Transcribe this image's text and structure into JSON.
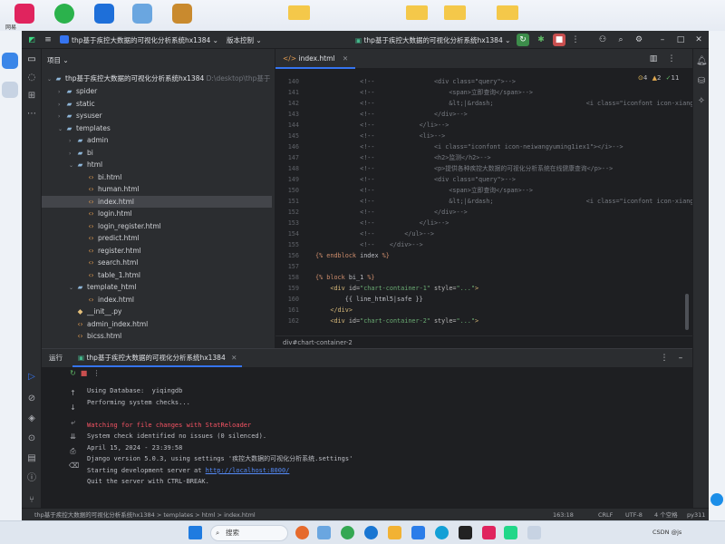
{
  "desktop": {
    "icons": [
      {
        "name": "app-1",
        "color": "#e0245e"
      },
      {
        "name": "app-2",
        "color": "#2bb24c"
      },
      {
        "name": "app-3",
        "color": "#1e6fd9"
      },
      {
        "name": "app-4",
        "color": "#6aa6e0"
      },
      {
        "name": "app-5",
        "color": "#c98a2e"
      }
    ],
    "top_label": "网易"
  },
  "titlebar": {
    "project": "thp基于疾控大数据的可视化分析系统hx1384",
    "vcs": "版本控制",
    "run_config": "thp基于疾控大数据的可视化分析系统hx1384"
  },
  "project_panel": {
    "header": "项目",
    "root": "thp基于疾控大数据的可视化分析系统hx1384",
    "root_path": "D:\\desktop\\thp基于",
    "tree": [
      {
        "label": "spider",
        "type": "folder",
        "depth": 1,
        "arrow": "›"
      },
      {
        "label": "static",
        "type": "folder",
        "depth": 1,
        "arrow": "›"
      },
      {
        "label": "sysuser",
        "type": "folder",
        "depth": 1,
        "arrow": "›"
      },
      {
        "label": "templates",
        "type": "folder",
        "depth": 1,
        "arrow": "⌄"
      },
      {
        "label": "admin",
        "type": "folder",
        "depth": 2,
        "arrow": "›"
      },
      {
        "label": "bi",
        "type": "folder",
        "depth": 2,
        "arrow": "›"
      },
      {
        "label": "html",
        "type": "folder",
        "depth": 2,
        "arrow": "⌄"
      },
      {
        "label": "bi.html",
        "type": "html",
        "depth": 3,
        "arrow": ""
      },
      {
        "label": "human.html",
        "type": "html",
        "depth": 3,
        "arrow": ""
      },
      {
        "label": "index.html",
        "type": "html",
        "depth": 3,
        "arrow": "",
        "selected": true
      },
      {
        "label": "login.html",
        "type": "html",
        "depth": 3,
        "arrow": ""
      },
      {
        "label": "login_register.html",
        "type": "html",
        "depth": 3,
        "arrow": ""
      },
      {
        "label": "predict.html",
        "type": "html",
        "depth": 3,
        "arrow": ""
      },
      {
        "label": "register.html",
        "type": "html",
        "depth": 3,
        "arrow": ""
      },
      {
        "label": "search.html",
        "type": "html",
        "depth": 3,
        "arrow": ""
      },
      {
        "label": "table_1.html",
        "type": "html",
        "depth": 3,
        "arrow": ""
      },
      {
        "label": "template_html",
        "type": "folder",
        "depth": 2,
        "arrow": "⌄"
      },
      {
        "label": "index.html",
        "type": "html",
        "depth": 3,
        "arrow": ""
      },
      {
        "label": "__init__.py",
        "type": "py",
        "depth": 2,
        "arrow": ""
      },
      {
        "label": "admin_index.html",
        "type": "html",
        "depth": 2,
        "arrow": ""
      },
      {
        "label": "bicss.html",
        "type": "html",
        "depth": 2,
        "arrow": ""
      }
    ]
  },
  "editor": {
    "tab": "index.html",
    "warnings": "4",
    "weak_warnings": "2",
    "typos": "11",
    "lines": [
      {
        "n": "140",
        "parts": [
          [
            "cm",
            "            <!--                <div class=\"query\">-->"
          ]
        ]
      },
      {
        "n": "141",
        "parts": [
          [
            "cm",
            "            <!--                    <span>立即查询</span>-->"
          ]
        ]
      },
      {
        "n": "142",
        "parts": [
          [
            "cm",
            "            <!--                    &lt;|&rdash;                         <i class=\"iconfont icon-xiangyou3\""
          ]
        ]
      },
      {
        "n": "143",
        "parts": [
          [
            "cm",
            "            <!--                </div>-->"
          ]
        ]
      },
      {
        "n": "144",
        "parts": [
          [
            "cm",
            "            <!--            </li>-->"
          ]
        ]
      },
      {
        "n": "145",
        "parts": [
          [
            "cm",
            "            <!--            <li>-->"
          ]
        ]
      },
      {
        "n": "146",
        "parts": [
          [
            "cm",
            "            <!--                <i class=\"iconfont icon-neiwangyuming1iex1\"></i>-->"
          ]
        ]
      },
      {
        "n": "147",
        "parts": [
          [
            "cm",
            "            <!--                <h2>监测</h2>-->"
          ]
        ]
      },
      {
        "n": "148",
        "parts": [
          [
            "cm",
            "            <!--                <p>提供各种疾控大数据的可视化分析系统在线健康查询</p>-->"
          ]
        ]
      },
      {
        "n": "149",
        "parts": [
          [
            "cm",
            "            <!--                <div class=\"query\">-->"
          ]
        ]
      },
      {
        "n": "150",
        "parts": [
          [
            "cm",
            "            <!--                    <span>立即查询</span>-->"
          ]
        ]
      },
      {
        "n": "151",
        "parts": [
          [
            "cm",
            "            <!--                    &lt;|&rdash;                         <i class=\"iconfont icon-xiangyou3\""
          ]
        ]
      },
      {
        "n": "152",
        "parts": [
          [
            "cm",
            "            <!--                </div>-->"
          ]
        ]
      },
      {
        "n": "153",
        "parts": [
          [
            "cm",
            "            <!--            </li>-->"
          ]
        ]
      },
      {
        "n": "154",
        "parts": [
          [
            "cm",
            "            <!--        </ul>-->"
          ]
        ]
      },
      {
        "n": "155",
        "parts": [
          [
            "cm",
            "            <!--    </div>-->"
          ]
        ]
      },
      {
        "n": "156",
        "parts": [
          [
            "kw",
            "{% endblock "
          ],
          [
            "tx",
            "index "
          ],
          [
            "kw",
            "%}"
          ]
        ]
      },
      {
        "n": "157",
        "parts": [
          [
            "tx",
            ""
          ]
        ]
      },
      {
        "n": "158",
        "parts": [
          [
            "kw",
            "{% block "
          ],
          [
            "tx",
            "bi_1 "
          ],
          [
            "kw",
            "%}"
          ]
        ]
      },
      {
        "n": "159",
        "parts": [
          [
            "tx",
            "    "
          ],
          [
            "tg",
            "<div "
          ],
          [
            "at",
            "id="
          ],
          [
            "st",
            "\"chart-container-1\" "
          ],
          [
            "at",
            "style="
          ],
          [
            "st",
            "\"...\""
          ],
          [
            "tg",
            ">"
          ]
        ]
      },
      {
        "n": "160",
        "parts": [
          [
            "tx",
            "        {{ line_html5|safe }}"
          ]
        ]
      },
      {
        "n": "161",
        "parts": [
          [
            "tx",
            "    "
          ],
          [
            "tg",
            "</div>"
          ]
        ]
      },
      {
        "n": "162",
        "parts": [
          [
            "tx",
            "    "
          ],
          [
            "tg",
            "<div "
          ],
          [
            "at",
            "id="
          ],
          [
            "st",
            "\"chart-container-2\" "
          ],
          [
            "at",
            "style="
          ],
          [
            "st",
            "\"...\""
          ],
          [
            "tg",
            ">"
          ]
        ]
      }
    ],
    "breadcrumb": "div#chart-container-2"
  },
  "run_panel": {
    "label": "运行",
    "tab": "thp基于疾控大数据的可视化分析系统hx1384",
    "console": [
      {
        "text": "Using Database:  yiqingdb",
        "red": false
      },
      {
        "text": "Performing system checks...",
        "red": false
      },
      {
        "text": "",
        "red": false
      },
      {
        "text": "Watching for file changes with StatReloader",
        "red": true
      },
      {
        "text": "System check identified no issues (0 silenced).",
        "red": false
      },
      {
        "text": "April 15, 2024 - 23:39:58",
        "red": false
      },
      {
        "text": "Django version 5.0.3, using settings '疾控大数据的可视化分析系统.settings'",
        "red": false
      },
      {
        "text": "Starting development server at ",
        "red": false,
        "link": "http://localhost:8000/"
      },
      {
        "text": "Quit the server with CTRL-BREAK.",
        "red": false
      }
    ]
  },
  "statusbar": {
    "path": "thp基于疾控大数据的可视化分析系统hx1384  >  templates  >  html  >  index.html",
    "position": "163:18",
    "line_sep": "CRLF",
    "encoding": "UTF-8",
    "indent": "4 个空格",
    "interpreter": "py311"
  },
  "taskbar": {
    "search_placeholder": "搜索",
    "watermark": "CSDN @js"
  }
}
